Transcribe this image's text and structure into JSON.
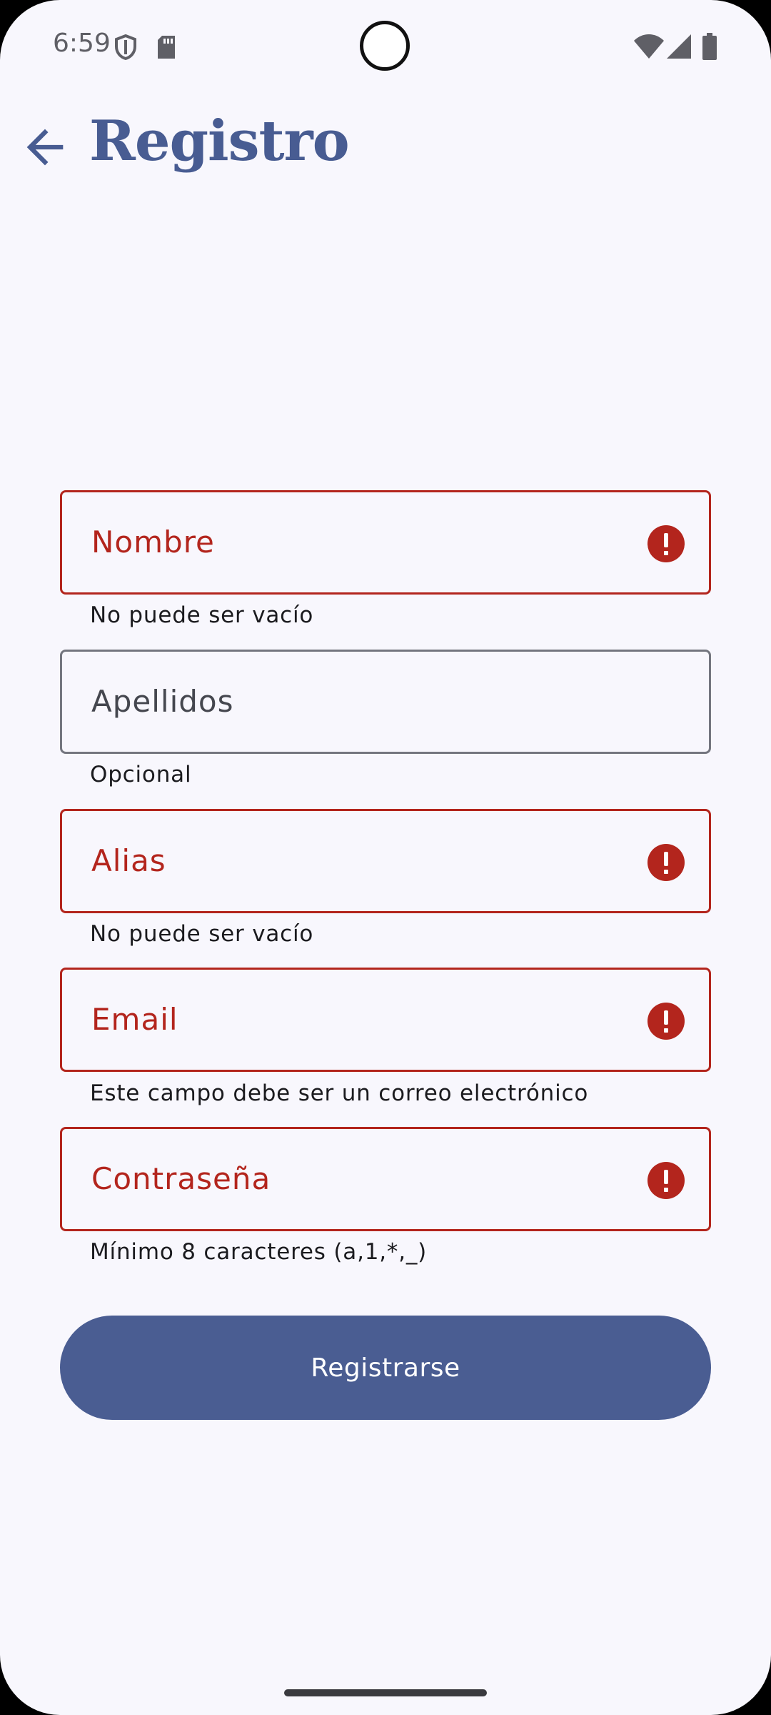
{
  "status_bar": {
    "time": "6:59",
    "icons": [
      "shield-icon",
      "sd-card-icon",
      "wifi-icon",
      "cell-signal-icon",
      "battery-icon"
    ]
  },
  "header": {
    "back_icon": "arrow-left-icon",
    "title": "Registro"
  },
  "form": {
    "fields": [
      {
        "label": "Nombre",
        "supporting_text": "No puede ser vacío",
        "state": "error"
      },
      {
        "label": "Apellidos",
        "supporting_text": "Opcional",
        "state": "normal"
      },
      {
        "label": "Alias",
        "supporting_text": "No puede ser vacío",
        "state": "error"
      },
      {
        "label": "Email",
        "supporting_text": "Este campo debe ser un correo electrónico",
        "state": "error"
      },
      {
        "label": "Contraseña",
        "supporting_text": "Mínimo 8 caracteres (a,1,*,_)",
        "state": "error"
      }
    ],
    "submit_label": "Registrarse"
  },
  "colors": {
    "primary": "#485c92",
    "error": "#b3251d",
    "background": "#f8f7fd",
    "outline": "#74767f"
  }
}
